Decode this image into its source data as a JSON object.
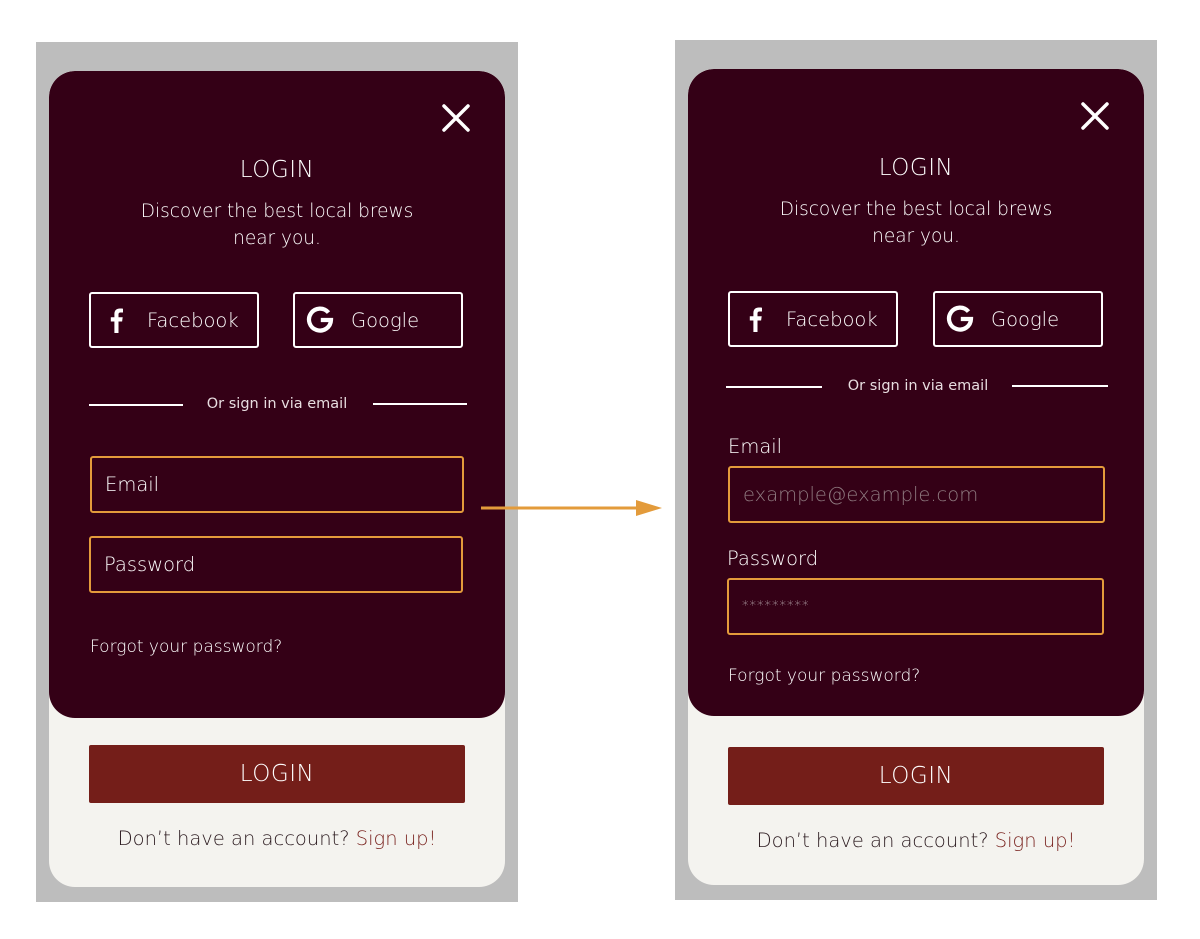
{
  "colors": {
    "card": "#340016",
    "screen": "#f4f3ef",
    "frame": "#bdbdbd",
    "field_border": "#e39b3b",
    "login_button": "#741e19",
    "signup_link": "#7a2420",
    "arrow": "#e39b3b"
  },
  "icons": {
    "close": "close-icon",
    "facebook": "facebook-icon",
    "google": "google-icon",
    "arrow": "arrow-right-icon"
  },
  "left": {
    "title": "LOGIN",
    "subtitle": "Discover the best local brews near you.",
    "facebook_label": "Facebook",
    "google_label": "Google",
    "divider_text": "Or sign in via email",
    "email_placeholder": "Email",
    "password_placeholder": "Password",
    "forgot": "Forgot your password?",
    "login_button": "LOGIN",
    "signup_prompt": "Don’t have an account?",
    "signup_link": "Sign up!"
  },
  "right": {
    "title": "LOGIN",
    "subtitle": "Discover the best local brews near you.",
    "facebook_label": "Facebook",
    "google_label": "Google",
    "divider_text": "Or sign in via email",
    "email_label": "Email",
    "email_placeholder": "example@example.com",
    "password_label": "Password",
    "password_value": "*********",
    "forgot": "Forgot your password?",
    "login_button": "LOGIN",
    "signup_prompt": "Don’t have an account?",
    "signup_link": "Sign up!"
  }
}
